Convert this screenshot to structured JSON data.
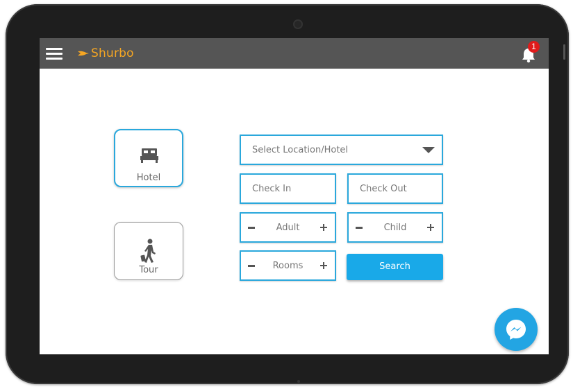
{
  "app": {
    "logo_text": "Shurbo",
    "notification_count": "1"
  },
  "colors": {
    "accent": "#2aa8dc",
    "topbar": "#555555",
    "logo": "#f5a623",
    "badge": "#e01b1b",
    "button": "#19a9e8"
  },
  "icons": {
    "menu": "hamburger-icon",
    "bell": "bell-icon",
    "hotel": "bed-icon",
    "tour": "traveler-icon",
    "chat": "messenger-icon"
  },
  "types": {
    "hotel": "Hotel",
    "tour": "Tour"
  },
  "form": {
    "location_placeholder": "Select Location/Hotel",
    "checkin_placeholder": "Check In",
    "checkout_placeholder": "Check Out",
    "adult_label": "Adult",
    "child_label": "Child",
    "rooms_label": "Rooms",
    "search_label": "Search"
  }
}
